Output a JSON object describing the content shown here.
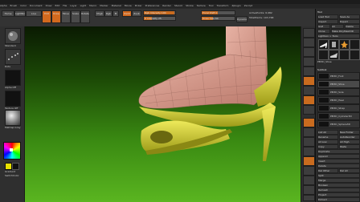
{
  "titlebar": {
    "text": "ZBrush 2018 - ..."
  },
  "menu": [
    "Alpha",
    "Brush",
    "Color",
    "Document",
    "Draw",
    "Edit",
    "File",
    "Layer",
    "Light",
    "Macro",
    "Marker",
    "Material",
    "Movie",
    "Picker",
    "Preferences",
    "Render",
    "Stencil",
    "Stroke",
    "Texture",
    "Tool",
    "Transform",
    "Zplugin",
    "Zscript"
  ],
  "topbar": {
    "home_page": "Home Page",
    "lightbox": "LightBox",
    "live_boolean": "Live Boolean",
    "edit": "Edit",
    "draw": "Draw",
    "move": "Move",
    "scale": "Scale",
    "rotate": "Rotate",
    "mrgb": "Mrgb",
    "rgb": "Rgb",
    "m": "M",
    "zadd": "Zadd",
    "zsub": "Zsub",
    "focal_shift": "Focal Shift 0",
    "z_intensity": "Z Intensity 25",
    "draw_size": "Draw Size 64",
    "active_points": "ActivePoints: 6,982",
    "total_points": "TotalPoints: 103,768",
    "rgb_intensity": "Rgb Intensity 100",
    "dynamic": "Dynamic"
  },
  "leftshelf": {
    "brush": "Standard",
    "stroke": "Dots",
    "alpha": "Alpha Off",
    "texture": "Texture Off",
    "material": "MatCap Gray",
    "gradient": "Gradient",
    "switch": "SwitchColor"
  },
  "rightshelf": [
    "Bpr",
    "SPix 3",
    "Scroll",
    "Zoom",
    "Actual",
    "AAHalf",
    "Persp",
    "Floor",
    "Local",
    "L.Sym",
    "Frame",
    "Move",
    "Scale",
    "Rotate",
    "Line Fill PolyF",
    "Transp",
    "Ghost",
    "Solo",
    "Xpose"
  ],
  "panel": {
    "header": "Tool",
    "load_tool": "Load Tool",
    "save_as": "Save As",
    "import": "Import",
    "export": "Export",
    "goz": "GoZ",
    "all": "All",
    "visible": "Visible",
    "clone": "Clone",
    "make_polymesh": "Make PolyMesh3D",
    "lightbox_tools": "Lightbox > Tools",
    "tool_name": "PM3D_Shoe",
    "subtool": "Subtool",
    "subtools": [
      "PM3D_Foot",
      "PM3D_Shoe",
      "PM3D_Sole",
      "PM3D_Heel",
      "PM3D_Strap",
      "PM3D_Cylinder3D",
      "PM3D_Sphere3D"
    ],
    "list_all": "List All",
    "new_folder": "New Folder",
    "rename": "Rename",
    "auto_reorder": "AutoReorder",
    "all_low": "All Low",
    "all_high": "All High",
    "copy": "Copy",
    "paste": "Paste",
    "duplicate": "Duplicate",
    "append": "Append",
    "insert": "Insert",
    "delete": "Delete",
    "del_other": "Del Other",
    "del_all": "Del All",
    "split": "Split",
    "merge": "Merge",
    "boolean": "Boolean",
    "remesh": "Remesh",
    "project": "Project",
    "extract": "Extract"
  },
  "colors": {
    "accent": "#c96b1f",
    "viewport_top": "#0a1a02",
    "viewport_bottom": "#5ab520",
    "shoe": "#d6d435",
    "foot": "#d99a8a"
  }
}
